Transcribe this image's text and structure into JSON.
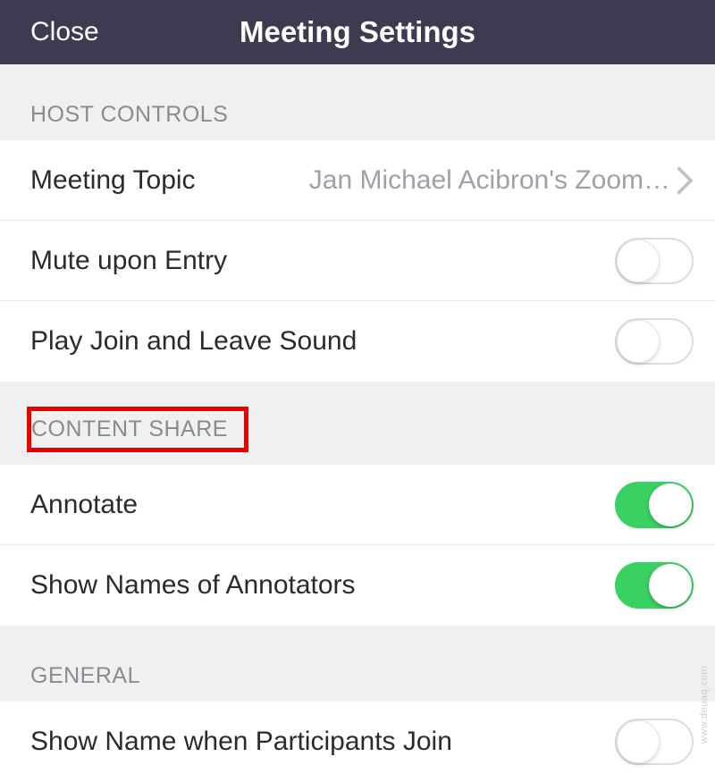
{
  "header": {
    "close_label": "Close",
    "title": "Meeting Settings"
  },
  "sections": {
    "host_controls": {
      "header": "HOST CONTROLS",
      "meeting_topic_label": "Meeting Topic",
      "meeting_topic_value": "Jan Michael Acibron's Zoom…",
      "mute_label": "Mute upon Entry",
      "play_sound_label": "Play Join and Leave Sound"
    },
    "content_share": {
      "header": "CONTENT SHARE",
      "annotate_label": "Annotate",
      "show_names_label": "Show Names of Annotators"
    },
    "general": {
      "header": "GENERAL",
      "show_name_join_label": "Show Name when Participants Join"
    }
  },
  "watermark": "www.deuaq.com"
}
